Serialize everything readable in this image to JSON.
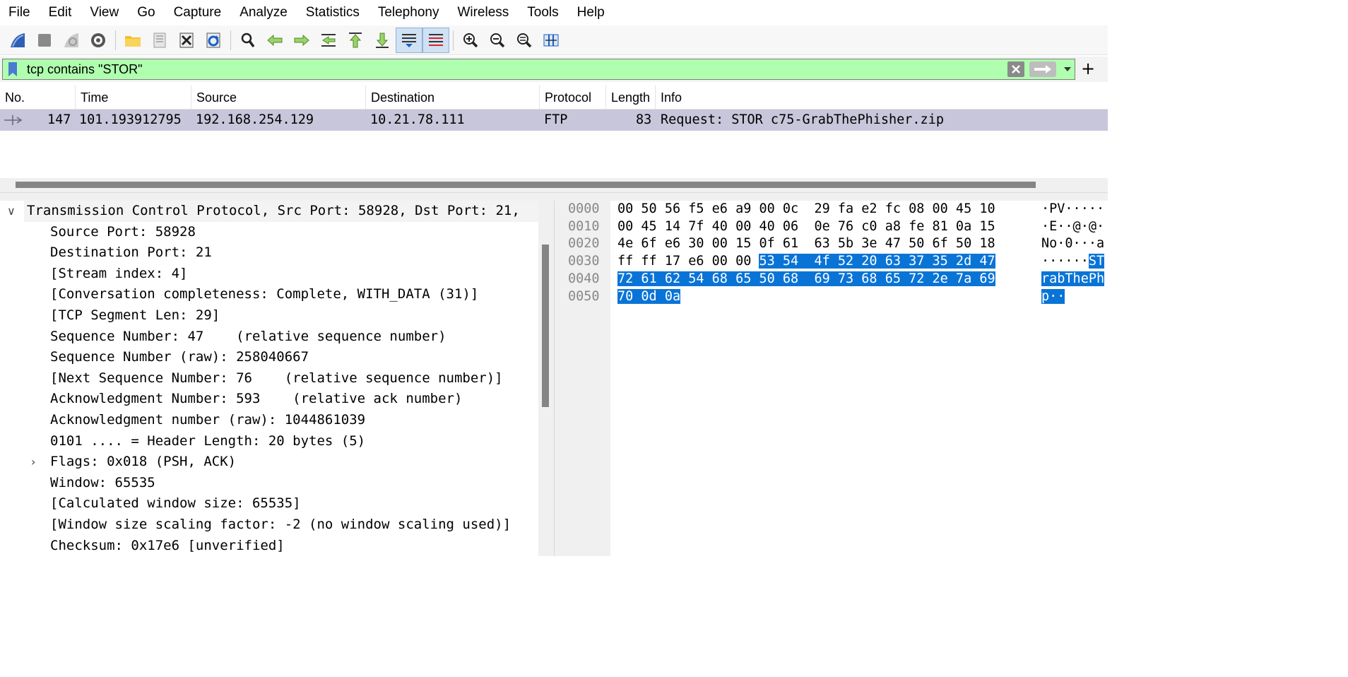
{
  "menu": [
    "File",
    "Edit",
    "View",
    "Go",
    "Capture",
    "Analyze",
    "Statistics",
    "Telephony",
    "Wireless",
    "Tools",
    "Help"
  ],
  "toolbar_icons": [
    "start-capture-icon",
    "stop-capture-icon",
    "restart-capture-icon",
    "capture-options-icon",
    "open-file-icon",
    "save-file-icon",
    "close-file-icon",
    "reload-file-icon",
    "find-packet-icon",
    "go-back-icon",
    "go-forward-icon",
    "go-to-packet-icon",
    "first-packet-icon",
    "last-packet-icon",
    "autoscroll-icon",
    "colorize-icon",
    "zoom-in-icon",
    "zoom-out-icon",
    "normal-size-icon",
    "resize-columns-icon"
  ],
  "filter": {
    "value": "tcp contains \"STOR\"",
    "color": "#afffaf"
  },
  "packet_list": {
    "columns": [
      "No.",
      "Time",
      "Source",
      "Destination",
      "Protocol",
      "Length",
      "Info"
    ],
    "rows": [
      {
        "no": "147",
        "time": "101.193912795",
        "source": "192.168.254.129",
        "destination": "10.21.78.111",
        "protocol": "FTP",
        "length": "83",
        "info": "Request: STOR c75-GrabThePhisher.zip"
      }
    ]
  },
  "details": {
    "top": "Transmission Control Protocol, Src Port: 58928, Dst Port: 21,",
    "lines": [
      "Source Port: 58928",
      "Destination Port: 21",
      "[Stream index: 4]",
      "[Conversation completeness: Complete, WITH_DATA (31)]",
      "[TCP Segment Len: 29]",
      "Sequence Number: 47    (relative sequence number)",
      "Sequence Number (raw): 258040667",
      "[Next Sequence Number: 76    (relative sequence number)]",
      "Acknowledgment Number: 593    (relative ack number)",
      "Acknowledgment number (raw): 1044861039",
      "0101 .... = Header Length: 20 bytes (5)",
      "Flags: 0x018 (PSH, ACK)",
      "Window: 65535",
      "[Calculated window size: 65535]",
      "[Window size scaling factor: -2 (no window scaling used)]",
      "Checksum: 0x17e6 [unverified]"
    ]
  },
  "bytes": {
    "offsets": [
      "0000",
      "0010",
      "0020",
      "0030",
      "0040",
      "0050"
    ],
    "hex": {
      "r0": "00 50 56 f5 e6 a9 00 0c  29 fa e2 fc 08 00 45 10",
      "r1": "00 45 14 7f 40 00 40 06  0e 76 c0 a8 fe 81 0a 15",
      "r2": "4e 6f e6 30 00 15 0f 61  63 5b 3e 47 50 6f 50 18",
      "r3_plain": "ff ff 17 e6 00 00 ",
      "r3_hl": "53 54  4f 52 20 63 37 35 2d 47",
      "r4_hl": "72 61 62 54 68 65 50 68  69 73 68 65 72 2e 7a 69",
      "r5_hl": "70 0d 0a"
    },
    "ascii": {
      "r0": "·PV·····",
      "r1": "·E··@·@·",
      "r2": "No·0···a",
      "r3_plain": "······",
      "r3_hl": "ST",
      "r4_hl": "rabThePh",
      "r5_hl": "p··"
    },
    "highlight_color": "#0a74d6"
  }
}
